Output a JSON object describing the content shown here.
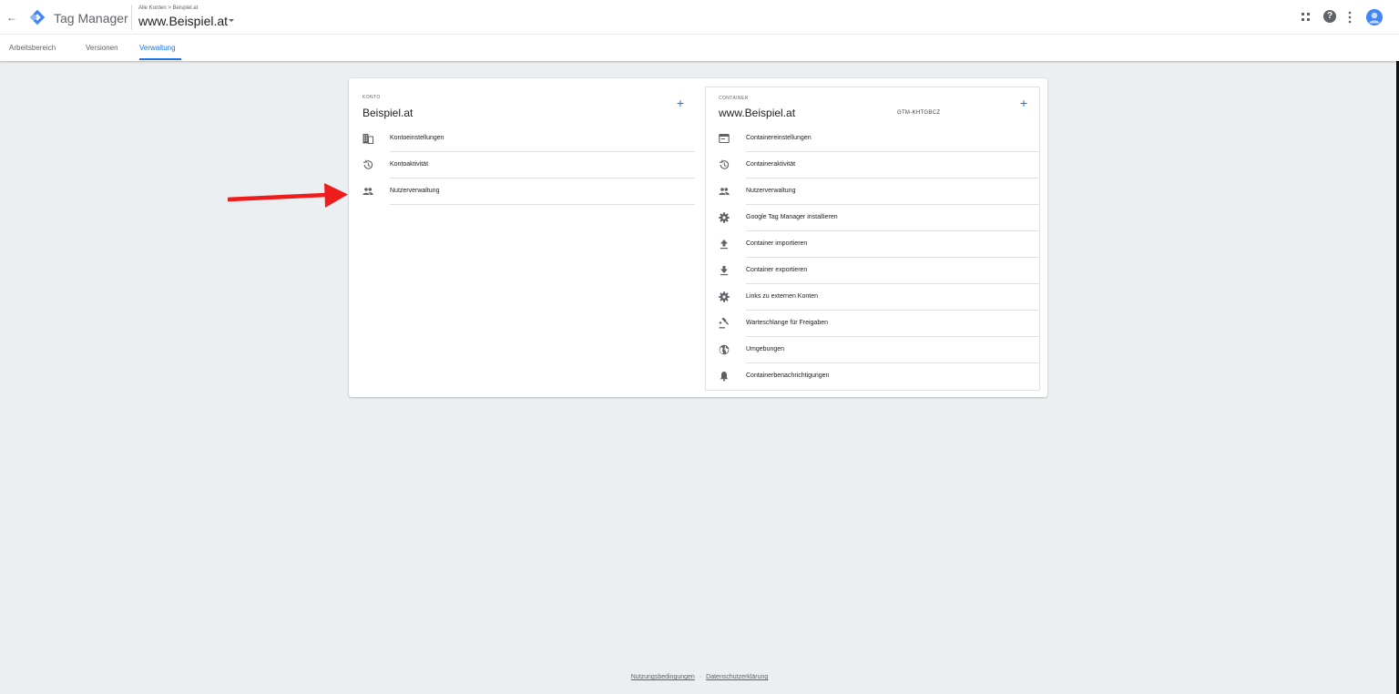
{
  "header": {
    "app_name": "Tag Manager",
    "breadcrumb": "Alle Konten > Beispiel.at",
    "container_name": "www.Beispiel.at",
    "brand_color": "#4285f4",
    "accent_color": "#1a73e8"
  },
  "tabs": [
    {
      "label": "Arbeitsbereich",
      "active": false
    },
    {
      "label": "Versionen",
      "active": false
    },
    {
      "label": "Verwaltung",
      "active": true
    }
  ],
  "top_icons": [
    "apps-grid-icon",
    "help-icon",
    "more-vert-icon",
    "account-avatar-icon"
  ],
  "account": {
    "section_label": "KONTO",
    "name": "Beispiel.at",
    "add_label": "+",
    "items": [
      {
        "label": "Kontoeinstellungen",
        "icon": "building-icon"
      },
      {
        "label": "Kontoaktivität",
        "icon": "history-icon"
      },
      {
        "label": "Nutzerverwaltung",
        "icon": "people-icon"
      }
    ]
  },
  "container": {
    "section_label": "CONTAINER",
    "name": "www.Beispiel.at",
    "id": "GTM-KHTGBCZ",
    "add_label": "+",
    "items": [
      {
        "label": "Containereinstellungen",
        "icon": "window-icon"
      },
      {
        "label": "Containeraktivität",
        "icon": "history-icon"
      },
      {
        "label": "Nutzerverwaltung",
        "icon": "people-icon"
      },
      {
        "label": "Google Tag Manager installieren",
        "icon": "gear-icon"
      },
      {
        "label": "Container importieren",
        "icon": "upload-icon"
      },
      {
        "label": "Container exportieren",
        "icon": "download-icon"
      },
      {
        "label": "Links zu externen Konten",
        "icon": "gear-icon"
      },
      {
        "label": "Warteschlange für Freigaben",
        "icon": "gavel-icon"
      },
      {
        "label": "Umgebungen",
        "icon": "globe-icon"
      },
      {
        "label": "Containerbenachrichtigungen",
        "icon": "bell-icon"
      }
    ]
  },
  "annotation": {
    "color": "#ee1c1c"
  },
  "footer": {
    "terms": "Nutzungsbedingungen",
    "separator": "·",
    "privacy": "Datenschutzerklärung"
  }
}
